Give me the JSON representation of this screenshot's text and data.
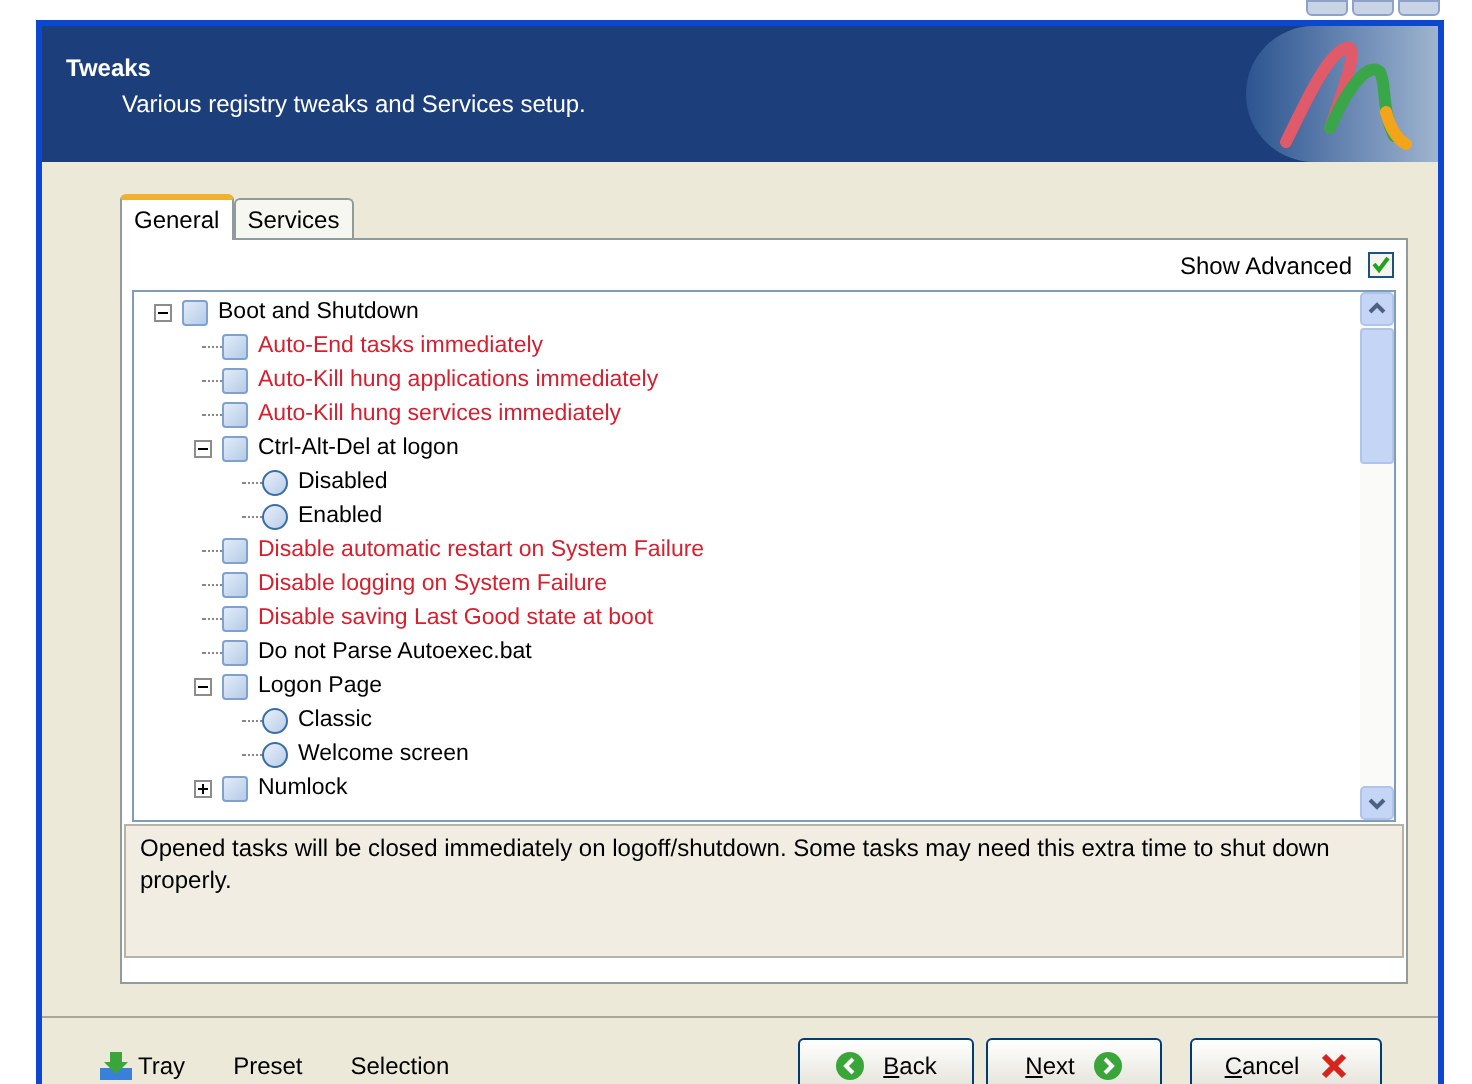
{
  "header": {
    "title": "Tweaks",
    "subtitle": "Various registry tweaks and Services setup."
  },
  "tabs": [
    {
      "label": "General",
      "selected": true
    },
    {
      "label": "Services",
      "selected": false
    }
  ],
  "show_advanced": {
    "label": "Show Advanced",
    "checked": true
  },
  "tree": [
    {
      "kind": "check",
      "label": "Boot and Shutdown",
      "advanced": false,
      "checked": false,
      "expanded": true,
      "children": [
        {
          "kind": "check",
          "label": "Auto-End tasks immediately",
          "advanced": true,
          "checked": false
        },
        {
          "kind": "check",
          "label": "Auto-Kill hung applications immediately",
          "advanced": true,
          "checked": false
        },
        {
          "kind": "check",
          "label": "Auto-Kill hung services immediately",
          "advanced": true,
          "checked": false
        },
        {
          "kind": "check",
          "label": "Ctrl-Alt-Del at logon",
          "advanced": false,
          "checked": false,
          "expanded": true,
          "children": [
            {
              "kind": "radio",
              "label": "Disabled",
              "advanced": false,
              "checked": false
            },
            {
              "kind": "radio",
              "label": "Enabled",
              "advanced": false,
              "checked": false
            }
          ]
        },
        {
          "kind": "check",
          "label": "Disable automatic restart on System Failure",
          "advanced": true,
          "checked": false
        },
        {
          "kind": "check",
          "label": "Disable logging on System Failure",
          "advanced": true,
          "checked": false
        },
        {
          "kind": "check",
          "label": "Disable saving Last Good state at boot",
          "advanced": true,
          "checked": false
        },
        {
          "kind": "check",
          "label": "Do not Parse Autoexec.bat",
          "advanced": false,
          "checked": false
        },
        {
          "kind": "check",
          "label": "Logon Page",
          "advanced": false,
          "checked": false,
          "expanded": true,
          "children": [
            {
              "kind": "radio",
              "label": "Classic",
              "advanced": false,
              "checked": false
            },
            {
              "kind": "radio",
              "label": "Welcome screen",
              "advanced": false,
              "checked": false
            }
          ]
        },
        {
          "kind": "check",
          "label": "Numlock",
          "advanced": false,
          "checked": false,
          "expanded": false
        }
      ]
    }
  ],
  "description": "Opened tasks will be closed immediately on logoff/shutdown. Some tasks may need this extra time to shut down properly.",
  "footer_links": [
    {
      "kind": "tray",
      "label": "Tray"
    },
    {
      "kind": "plain",
      "label": "Preset"
    },
    {
      "kind": "plain",
      "label": "Selection"
    }
  ],
  "buttons": [
    {
      "kind": "back",
      "accelerator": "B",
      "label_rest": "ack"
    },
    {
      "kind": "next",
      "accelerator": "N",
      "label_rest": "ext"
    },
    {
      "kind": "cancel",
      "accelerator": "C",
      "label_rest": "ancel"
    }
  ]
}
